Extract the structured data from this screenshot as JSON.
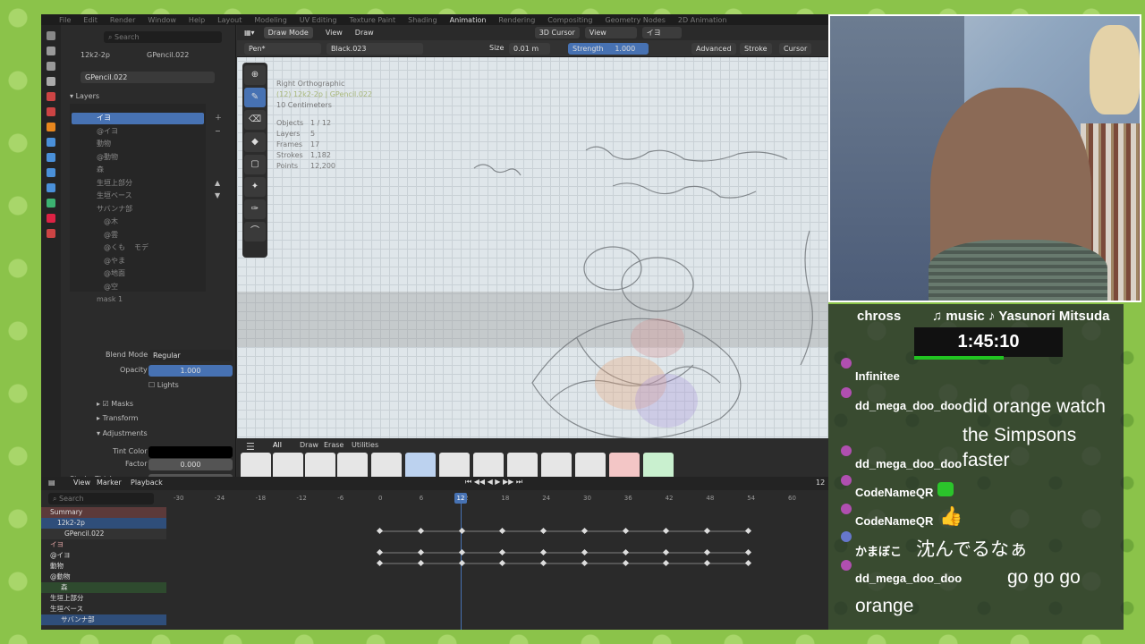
{
  "menu": {
    "items": [
      "File",
      "Edit",
      "Render",
      "Window",
      "Help",
      "Layout",
      "Modeling",
      "UV Editing",
      "Texture Paint",
      "Shading",
      "Animation",
      "Rendering",
      "Compositing",
      "Geometry Nodes",
      "2D Animation"
    ]
  },
  "props_panel": {
    "search_placeholder": "Search",
    "object_name": "12k2-2p",
    "gp_name": "GPencil.022",
    "data_name": "GPencil.022",
    "layers_label": "Layers",
    "layers": [
      "イヨ",
      "@イヨ",
      "動物",
      "@動物",
      "森",
      "生垣上部分",
      "生垣ベース",
      "サバンナ部",
      "@木",
      "@雲",
      "@くも",
      "@やま",
      "@地面",
      "@空",
      "mask 1"
    ],
    "layer_extra": "モデ",
    "blend_mode_label": "Blend Mode",
    "blend_mode_value": "Regular",
    "opacity_label": "Opacity",
    "opacity_value": "1.000",
    "lights_label": "Lights",
    "masks_label": "Masks",
    "transform_label": "Transform",
    "adjustments_label": "Adjustments",
    "tint_color_label": "Tint Color",
    "factor_label": "Factor",
    "factor_value": "0.000",
    "stroke_thickness_label": "Stroke Thickness",
    "stroke_thickness_value": "0 m"
  },
  "viewport": {
    "mode": "Draw Mode",
    "view": "View",
    "draw": "Draw",
    "cursor_menu": "3D Cursor",
    "view2": "View",
    "layer_sel": "イヨ",
    "brush": "Pen*",
    "material": "Black.023",
    "size_label": "Size",
    "size_value": "0.01 m",
    "strength_label": "Strength",
    "strength_value": "1.000",
    "advanced": "Advanced",
    "stroke": "Stroke",
    "cursor": "Cursor",
    "overlay": {
      "view_name": "Right Orthographic",
      "object_info": "(12) 12k2-2p | GPencil.022",
      "scale": "10 Centimeters",
      "stats": [
        [
          "Objects",
          "1 / 12"
        ],
        [
          "Layers",
          "5"
        ],
        [
          "Frames",
          "17"
        ],
        [
          "Strokes",
          "1,182"
        ],
        [
          "Points",
          "12,200"
        ]
      ]
    },
    "brush_tabs": [
      "All",
      "Draw",
      "Erase",
      "Utilities"
    ]
  },
  "timeline": {
    "view": "View",
    "marker": "Marker",
    "playback": "Playback",
    "search_placeholder": "Search",
    "frame_current": "12",
    "ruler": [
      "-30",
      "-24",
      "-18",
      "-12",
      "-6",
      "0",
      "6",
      "12",
      "18",
      "24",
      "30",
      "36",
      "42",
      "48",
      "54",
      "60"
    ],
    "channels": [
      "Summary",
      "12k2-2p",
      "GPencil.022",
      "イヨ",
      "@イヨ",
      "動物",
      "@動物",
      "森",
      "生垣上部分",
      "生垣ベース",
      "サバンナ部"
    ]
  },
  "stream": {
    "streamer": "chross",
    "music": "♫ music ♪ Yasunori Mitsuda",
    "timer": "1:45:10",
    "messages": [
      {
        "user": "Infinitee",
        "text": ""
      },
      {
        "user": "dd_mega_doo_doo",
        "text": "did orange watch the Simpsons"
      },
      {
        "user": "dd_mega_doo_doo",
        "text": "faster"
      },
      {
        "user": "CodeNameQR",
        "text": ""
      },
      {
        "user": "CodeNameQR",
        "text": "👍"
      },
      {
        "user": "かまぼこ",
        "text": "沈んでるなぁ"
      },
      {
        "user": "dd_mega_doo_doo",
        "text": "go go go orange"
      }
    ]
  },
  "colors": {
    "accent": "#4772b3",
    "highlight": "#5680c2",
    "bg": "#303030",
    "vp_bg": "#dfe6ea",
    "timer_green": "#21c421"
  }
}
